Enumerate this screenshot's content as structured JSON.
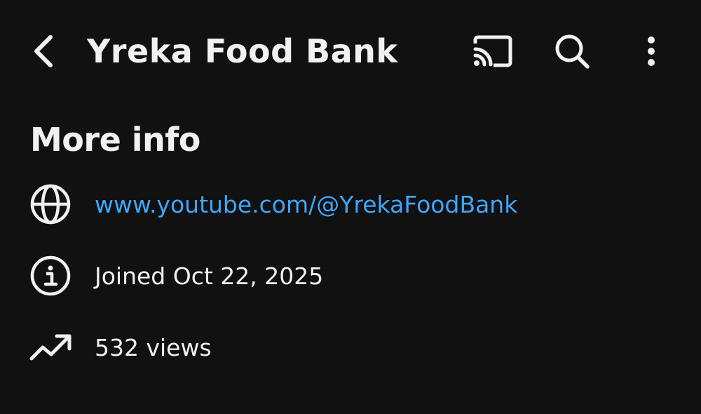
{
  "header": {
    "title": "Yreka Food Bank",
    "icons": {
      "back": "chevron-left-icon",
      "cast": "cast-icon",
      "search": "search-icon",
      "more": "more-vertical-icon"
    }
  },
  "more_info": {
    "heading": "More info",
    "link": {
      "icon": "globe-icon",
      "text": "www.youtube.com/@YrekaFoodBank"
    },
    "joined": {
      "icon": "info-icon",
      "text": "Joined Oct 22, 2025"
    },
    "views": {
      "icon": "trending-up-icon",
      "text": "532 views"
    }
  },
  "colors": {
    "background": "#111111",
    "text": "#f1f1f1",
    "link": "#3ea6ff"
  }
}
